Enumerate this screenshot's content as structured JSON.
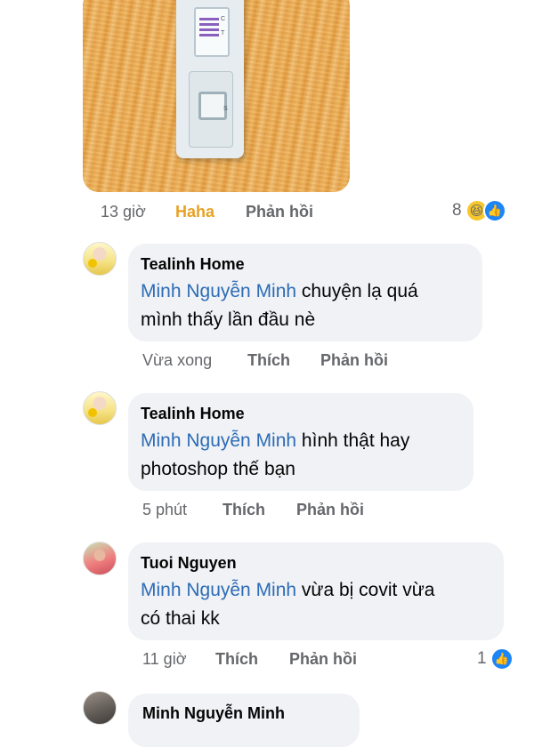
{
  "post_photo": {
    "subject": "test-cassette",
    "letters": {
      "c": "C",
      "t": "T",
      "s": "S"
    }
  },
  "post_meta": {
    "time": "13 giờ",
    "haha": "Haha",
    "reply": "Phản hồi",
    "reaction_count": "8",
    "reaction_icons": [
      "haha-emoji-icon",
      "like-icon"
    ]
  },
  "comments": [
    {
      "author": "Tealinh Home",
      "mention": "Minh Nguyễn Minh",
      "text_line1": " chuyện lạ quá",
      "text_line2": "mình thấy lần đầu nè",
      "time": "Vừa xong",
      "like": "Thích",
      "reply": "Phản hồi"
    },
    {
      "author": "Tealinh Home",
      "mention": "Minh Nguyễn Minh",
      "text_line1": " hình thật hay",
      "text_line2": "photoshop thế bạn",
      "time": "5 phút",
      "like": "Thích",
      "reply": "Phản hồi"
    },
    {
      "author": "Tuoi Nguyen",
      "mention": "Minh Nguyễn Minh",
      "text_line1": " vừa bị covit vừa",
      "text_line2": "có thai kk",
      "time": "11 giờ",
      "like": "Thích",
      "reply": "Phản hồi",
      "reaction_count": "1"
    }
  ],
  "partial_comment": {
    "author": "Minh Nguyễn Minh"
  },
  "colors": {
    "bubble": "#f0f2f5",
    "mention": "#2d6cb6",
    "meta": "#65676b",
    "haha": "#e7a226",
    "like": "#1d86f6"
  }
}
